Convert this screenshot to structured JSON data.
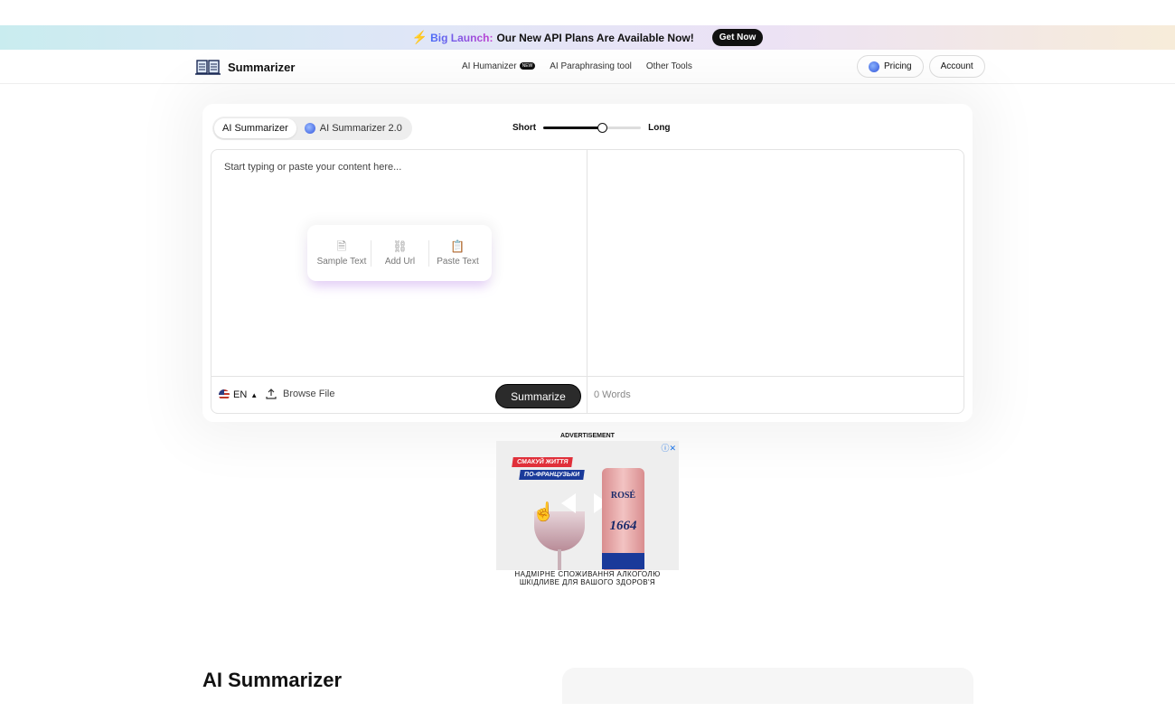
{
  "promo": {
    "bolt": "⚡",
    "launch": "Big Launch:",
    "message": "Our New API Plans Are Available Now!",
    "cta": "Get Now"
  },
  "nav": {
    "brand": "Summarizer",
    "links": [
      {
        "label": "AI Humanizer",
        "badge": "NEW"
      },
      {
        "label": "AI Paraphrasing tool"
      },
      {
        "label": "Other Tools"
      }
    ],
    "pricing": "Pricing",
    "account": "Account"
  },
  "tool": {
    "tabs": [
      {
        "label": "AI Summarizer",
        "active": true
      },
      {
        "label": "AI Summarizer 2.0",
        "active": false
      }
    ],
    "length": {
      "min_label": "Short",
      "max_label": "Long",
      "value": 0.6
    },
    "input_placeholder": "Start typing or paste your content here...",
    "actions": [
      {
        "label": "Sample Text",
        "icon": "document-icon"
      },
      {
        "label": "Add Url",
        "icon": "link-icon"
      },
      {
        "label": "Paste Text",
        "icon": "clipboard-icon"
      }
    ],
    "language": "EN",
    "browse_label": "Browse File",
    "summarize_label": "Summarize",
    "word_count": "0 Words"
  },
  "ad": {
    "label": "ADVERTISEMENT",
    "tag1": "СМАКУЙ ЖИТТЯ",
    "tag2": "ПО-ФРАНЦУЗЬКИ",
    "can_brand": "ROSÉ",
    "can_number": "1664",
    "warning": "НАДМІРНЕ СПОЖИВАННЯ АЛКОГОЛЮ ШКІДЛИВЕ ДЛЯ ВАШОГО ЗДОРОВ'Я"
  },
  "section": {
    "title": "AI Summarizer"
  }
}
